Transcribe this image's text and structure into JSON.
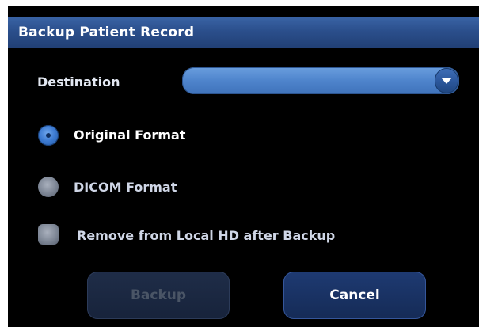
{
  "dialog": {
    "title": "Backup Patient Record",
    "destination": {
      "label": "Destination",
      "selected_value": ""
    },
    "format_options": [
      {
        "label": "Original Format",
        "selected": true
      },
      {
        "label": "DICOM Format",
        "selected": false
      }
    ],
    "remove_option": {
      "label": "Remove from Local HD after Backup",
      "checked": false
    },
    "buttons": {
      "backup": {
        "label": "Backup",
        "enabled": false
      },
      "cancel": {
        "label": "Cancel",
        "enabled": true
      }
    }
  },
  "colors": {
    "titlebar": "#2b4f8c",
    "dropdown": "#4e84cc",
    "background": "#000000",
    "button_disabled_text": "#4a5566"
  },
  "icons": {
    "dropdown": "chevron-down-icon"
  }
}
